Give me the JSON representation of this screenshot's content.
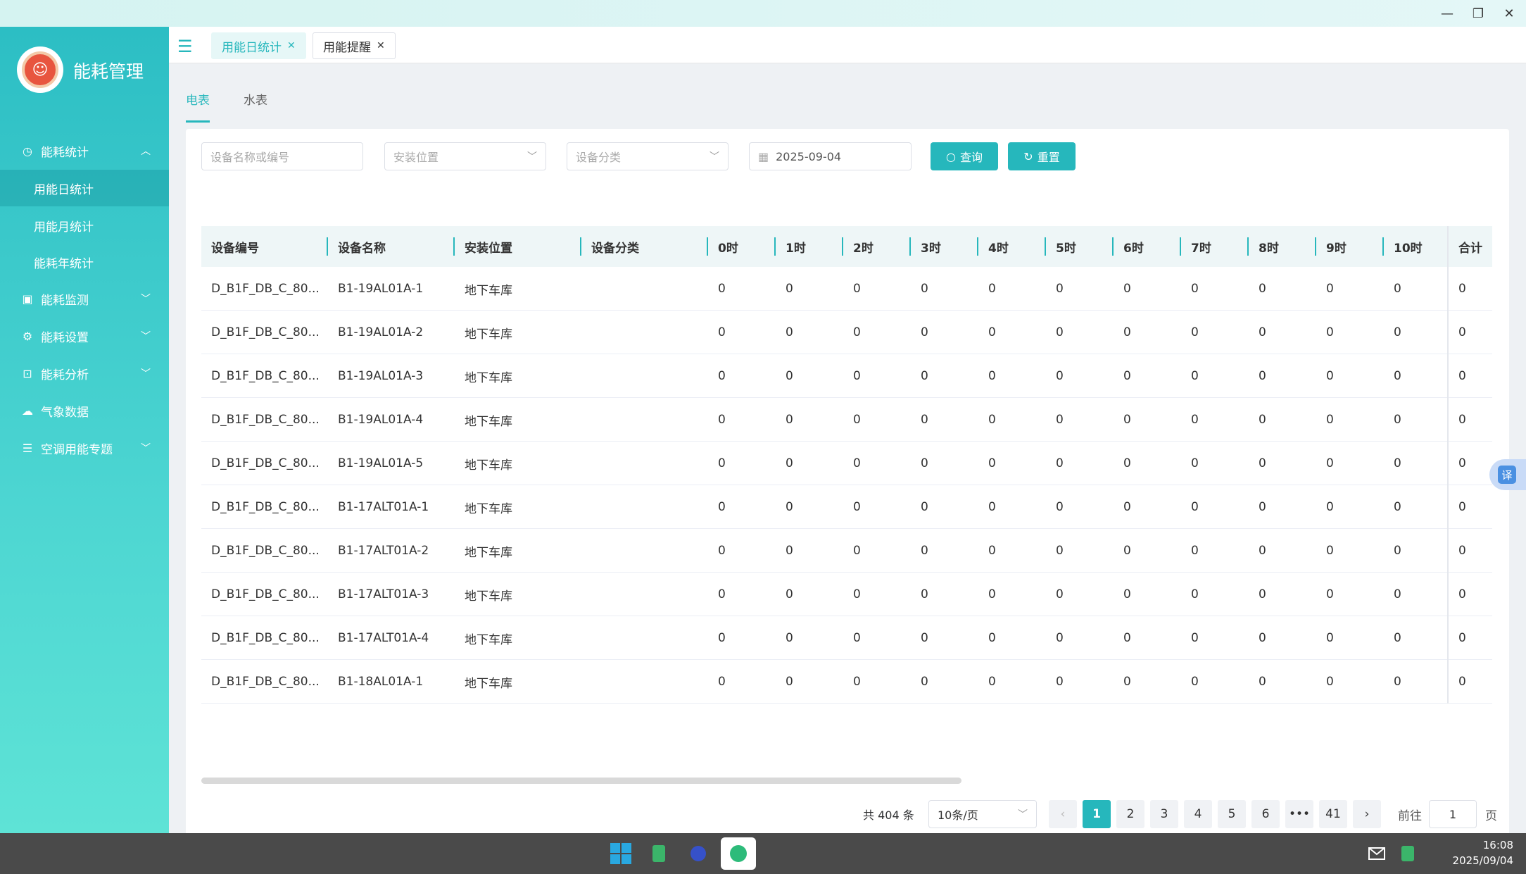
{
  "window": {
    "minimize": "—",
    "restore": "❐",
    "close": "✕"
  },
  "sidebar": {
    "title": "能耗管理",
    "menu": [
      {
        "label": "能耗统计",
        "icon": "clock-icon",
        "expanded": true
      },
      {
        "label": "能耗监测",
        "icon": "monitor-icon"
      },
      {
        "label": "能耗设置",
        "icon": "gear-icon"
      },
      {
        "label": "能耗分析",
        "icon": "chart-icon"
      },
      {
        "label": "气象数据",
        "icon": "cloud-icon"
      },
      {
        "label": "空调用能专题",
        "icon": "list-icon"
      }
    ],
    "submenu": [
      "用能日统计",
      "用能月统计",
      "能耗年统计"
    ]
  },
  "tabs": [
    {
      "label": "用能日统计",
      "active": true
    },
    {
      "label": "用能提醒",
      "active": false
    }
  ],
  "subtabs": [
    {
      "label": "电表",
      "active": true
    },
    {
      "label": "水表",
      "active": false
    }
  ],
  "filters": {
    "device_placeholder": "设备名称或编号",
    "location_placeholder": "安装位置",
    "category_placeholder": "设备分类",
    "date_value": "2025-09-04",
    "query_label": "查询",
    "reset_label": "重置"
  },
  "table": {
    "columns": [
      "设备编号",
      "设备名称",
      "安装位置",
      "设备分类",
      "0时",
      "1时",
      "2时",
      "3时",
      "4时",
      "5时",
      "6时",
      "7时",
      "8时",
      "9时",
      "10时",
      "合计"
    ],
    "rows": [
      {
        "code": "D_B1F_DB_C_80...",
        "name": "B1-19AL01A-1",
        "loc": "地下车库",
        "cat": "",
        "h": [
          "0",
          "0",
          "0",
          "0",
          "0",
          "0",
          "0",
          "0",
          "0",
          "0",
          "0"
        ],
        "total": "0"
      },
      {
        "code": "D_B1F_DB_C_80...",
        "name": "B1-19AL01A-2",
        "loc": "地下车库",
        "cat": "",
        "h": [
          "0",
          "0",
          "0",
          "0",
          "0",
          "0",
          "0",
          "0",
          "0",
          "0",
          "0"
        ],
        "total": "0"
      },
      {
        "code": "D_B1F_DB_C_80...",
        "name": "B1-19AL01A-3",
        "loc": "地下车库",
        "cat": "",
        "h": [
          "0",
          "0",
          "0",
          "0",
          "0",
          "0",
          "0",
          "0",
          "0",
          "0",
          "0"
        ],
        "total": "0"
      },
      {
        "code": "D_B1F_DB_C_80...",
        "name": "B1-19AL01A-4",
        "loc": "地下车库",
        "cat": "",
        "h": [
          "0",
          "0",
          "0",
          "0",
          "0",
          "0",
          "0",
          "0",
          "0",
          "0",
          "0"
        ],
        "total": "0"
      },
      {
        "code": "D_B1F_DB_C_80...",
        "name": "B1-19AL01A-5",
        "loc": "地下车库",
        "cat": "",
        "h": [
          "0",
          "0",
          "0",
          "0",
          "0",
          "0",
          "0",
          "0",
          "0",
          "0",
          "0"
        ],
        "total": "0"
      },
      {
        "code": "D_B1F_DB_C_80...",
        "name": "B1-17ALT01A-1",
        "loc": "地下车库",
        "cat": "",
        "h": [
          "0",
          "0",
          "0",
          "0",
          "0",
          "0",
          "0",
          "0",
          "0",
          "0",
          "0"
        ],
        "total": "0"
      },
      {
        "code": "D_B1F_DB_C_80...",
        "name": "B1-17ALT01A-2",
        "loc": "地下车库",
        "cat": "",
        "h": [
          "0",
          "0",
          "0",
          "0",
          "0",
          "0",
          "0",
          "0",
          "0",
          "0",
          "0"
        ],
        "total": "0"
      },
      {
        "code": "D_B1F_DB_C_80...",
        "name": "B1-17ALT01A-3",
        "loc": "地下车库",
        "cat": "",
        "h": [
          "0",
          "0",
          "0",
          "0",
          "0",
          "0",
          "0",
          "0",
          "0",
          "0",
          "0"
        ],
        "total": "0"
      },
      {
        "code": "D_B1F_DB_C_80...",
        "name": "B1-17ALT01A-4",
        "loc": "地下车库",
        "cat": "",
        "h": [
          "0",
          "0",
          "0",
          "0",
          "0",
          "0",
          "0",
          "0",
          "0",
          "0",
          "0"
        ],
        "total": "0"
      },
      {
        "code": "D_B1F_DB_C_80...",
        "name": "B1-18AL01A-1",
        "loc": "地下车库",
        "cat": "",
        "h": [
          "0",
          "0",
          "0",
          "0",
          "0",
          "0",
          "0",
          "0",
          "0",
          "0",
          "0"
        ],
        "total": "0"
      }
    ]
  },
  "pagination": {
    "total": "共 404 条",
    "page_size": "10条/页",
    "pages": [
      "1",
      "2",
      "3",
      "4",
      "5",
      "6",
      "•••",
      "41"
    ],
    "current": "1",
    "goto_label": "前往",
    "goto_value": "1",
    "page_unit": "页",
    "prev": "‹",
    "next": "›"
  },
  "translate_label": "译",
  "taskbar": {
    "time": "16:08",
    "date": "2025/09/04"
  },
  "colors": {
    "accent": "#26b7bc",
    "sidebar_top": "#2cbec4",
    "sidebar_bottom": "#5ee3d6"
  }
}
